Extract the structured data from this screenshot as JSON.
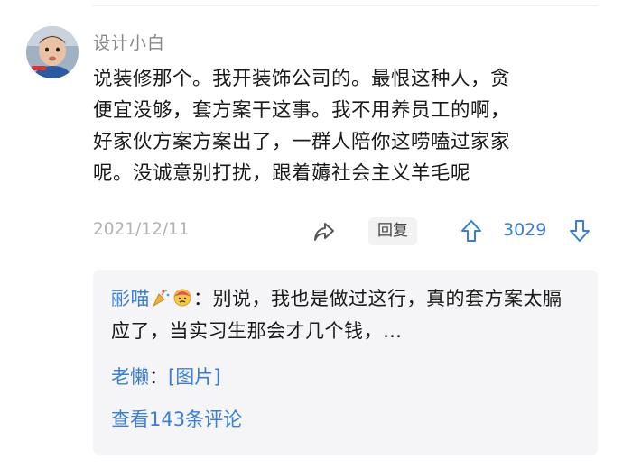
{
  "comment": {
    "username": "设计小白",
    "content": "说装修那个。我开装饰公司的。最恨这种人，贪\n便宜没够，套方案干这事。我不用养员工的啊，\n好家伙方案方案出了，一群人陪你这唠嗑过家家\n呢。没诚意别打扰，跟着薅社会主义羊毛呢",
    "date": "2021/12/11",
    "reply_label": "回复",
    "vote_count": "3029"
  },
  "replies": {
    "items": [
      {
        "author": "彨喵",
        "separator": "：",
        "text": "别说，我也是做过这行，真的套方案太膈应了，当实习生那会才几个钱，…"
      },
      {
        "author": "老懒",
        "separator": "：",
        "text": "[图片]"
      }
    ],
    "view_all_label": "查看143条评论"
  },
  "colors": {
    "accent_blue": "#3a7fd5",
    "meta_gray": "#b3b3b3",
    "box_bg": "#f5f5f7"
  },
  "icons": [
    "avatar-photo",
    "share-icon",
    "upvote-arrow-icon",
    "downvote-arrow-icon",
    "party-popper-emoji",
    "face-emoji"
  ]
}
